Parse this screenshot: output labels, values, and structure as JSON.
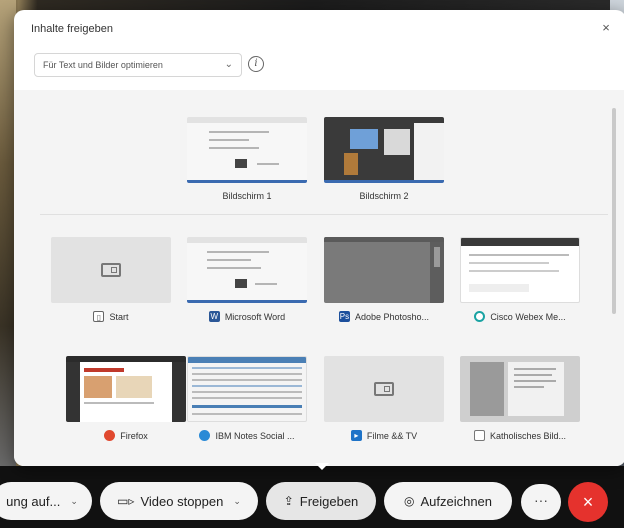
{
  "dialog": {
    "title": "Inhalte freigeben",
    "close": "×",
    "optimize_select": "Für Text und Bilder optimieren",
    "info": "i"
  },
  "screens": [
    {
      "label": "Bildschirm 1"
    },
    {
      "label": "Bildschirm 2"
    }
  ],
  "apps": [
    {
      "label": "Start",
      "icon": "window-icon",
      "color": "#666666"
    },
    {
      "label": "Microsoft Word",
      "icon": "word-icon",
      "color": "#2b5797"
    },
    {
      "label": "Adobe Photosho...",
      "icon": "photoshop-icon",
      "color": "#1c4f9c"
    },
    {
      "label": "Cisco Webex Me...",
      "icon": "webex-icon",
      "color": "#1aa3a3"
    },
    {
      "label": "Firefox",
      "icon": "firefox-icon",
      "color": "#e0482e"
    },
    {
      "label": "IBM Notes Social ...",
      "icon": "ibm-notes-icon",
      "color": "#2a8ad6"
    },
    {
      "label": "Filme && TV",
      "icon": "movies-tv-icon",
      "color": "#1e73c8"
    },
    {
      "label": "Katholisches Bild...",
      "icon": "window-outline-icon",
      "color": "#777777"
    }
  ],
  "toolbar": {
    "audio_label": "ung auf...",
    "video_label": "Video stoppen",
    "share_label": "Freigeben",
    "record_label": "Aufzeichnen",
    "more_label": "···",
    "end_label": "×"
  },
  "colors": {
    "accent": "#3a6ab0",
    "end_call": "#e5322d"
  }
}
